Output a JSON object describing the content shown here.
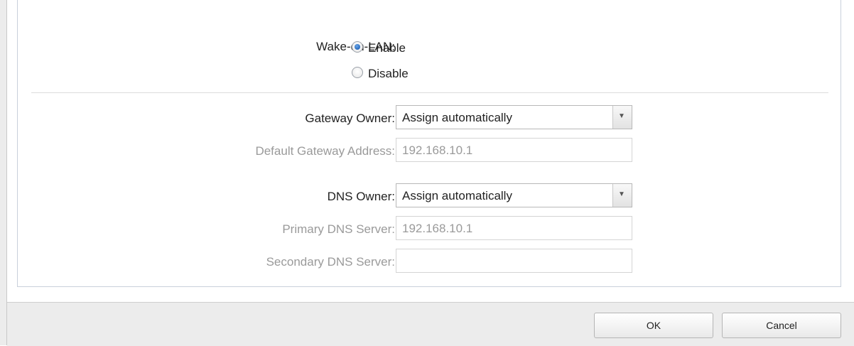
{
  "wake_on_lan": {
    "label": "Wake-on-LAN:",
    "options": [
      {
        "label": "Enable",
        "checked": true
      },
      {
        "label": "Disable",
        "checked": false
      }
    ]
  },
  "gateway": {
    "owner_label": "Gateway Owner:",
    "owner_value": "Assign automatically",
    "address_label": "Default Gateway Address:",
    "address_value": "192.168.10.1"
  },
  "dns": {
    "owner_label": "DNS Owner:",
    "owner_value": "Assign automatically",
    "primary_label": "Primary DNS Server:",
    "primary_value": "192.168.10.1",
    "secondary_label": "Secondary DNS Server:",
    "secondary_value": ""
  },
  "footer": {
    "ok_label": "OK",
    "cancel_label": "Cancel"
  },
  "icons": {
    "dropdown": "chevron-down-icon"
  }
}
